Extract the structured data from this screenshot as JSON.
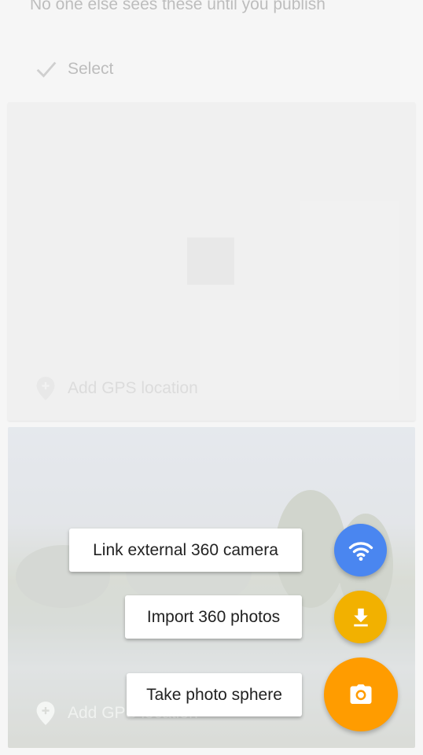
{
  "header": {
    "subtitle": "No one else sees these until you publish",
    "select_label": "Select"
  },
  "cards": [
    {
      "gps_label": "Add GPS location"
    },
    {
      "gps_label": "Add GPS location"
    }
  ],
  "speed_dial": {
    "items": [
      {
        "label": "Link external 360 camera",
        "icon": "wifi-icon",
        "color": "#4285f4"
      },
      {
        "label": "Import 360 photos",
        "icon": "download-icon",
        "color": "#f4b400"
      },
      {
        "label": "Take photo sphere",
        "icon": "camera-icon",
        "color": "#ff9800"
      }
    ]
  }
}
